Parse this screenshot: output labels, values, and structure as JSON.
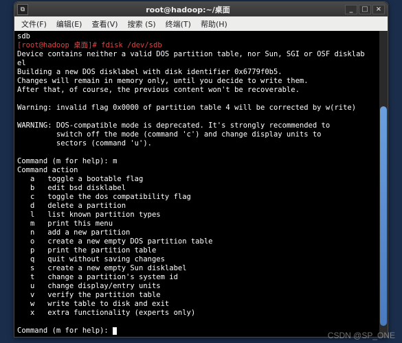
{
  "titlebar": {
    "icon_glyph": "⧉",
    "title": "root@hadoop:~/桌面",
    "min": "_",
    "max": "□",
    "close": "×"
  },
  "menubar": {
    "file": "文件(F)",
    "edit": "编辑(E)",
    "view": "查看(V)",
    "search": "搜索 (S)",
    "term": "终端(T)",
    "help": "帮助(H)"
  },
  "terminal": {
    "line_sdb": "sdb",
    "prompt_fdisk": "[root@hadoop 桌面]# fdisk /dev/sdb",
    "dev1": "Device contains neither a valid DOS partition table, nor Sun, SGI or OSF disklab",
    "dev2": "el",
    "build": "Building a new DOS disklabel with disk identifier 0x6779f0b5.",
    "chg": "Changes will remain in memory only, until you decide to write them.",
    "after": "After that, of course, the previous content won't be recoverable.",
    "warn1": "Warning: invalid flag 0x0000 of partition table 4 will be corrected by w(rite)",
    "warn2a": "WARNING: DOS-compatible mode is deprecated. It's strongly recommended to",
    "warn2b": "         switch off the mode (command 'c') and change display units to",
    "warn2c": "         sectors (command 'u').",
    "cmd_m": "Command (m for help): m",
    "cmd_action": "Command action",
    "a": "   a   toggle a bootable flag",
    "b": "   b   edit bsd disklabel",
    "c": "   c   toggle the dos compatibility flag",
    "d": "   d   delete a partition",
    "l": "   l   list known partition types",
    "m": "   m   print this menu",
    "n": "   n   add a new partition",
    "o": "   o   create a new empty DOS partition table",
    "p": "   p   print the partition table",
    "q": "   q   quit without saving changes",
    "s": "   s   create a new empty Sun disklabel",
    "t": "   t   change a partition's system id",
    "u": "   u   change display/entry units",
    "v": "   v   verify the partition table",
    "w": "   w   write table to disk and exit",
    "x": "   x   extra functionality (experts only)",
    "prompt2": "Command (m for help): "
  },
  "watermark": "CSDN @SP_ONE"
}
